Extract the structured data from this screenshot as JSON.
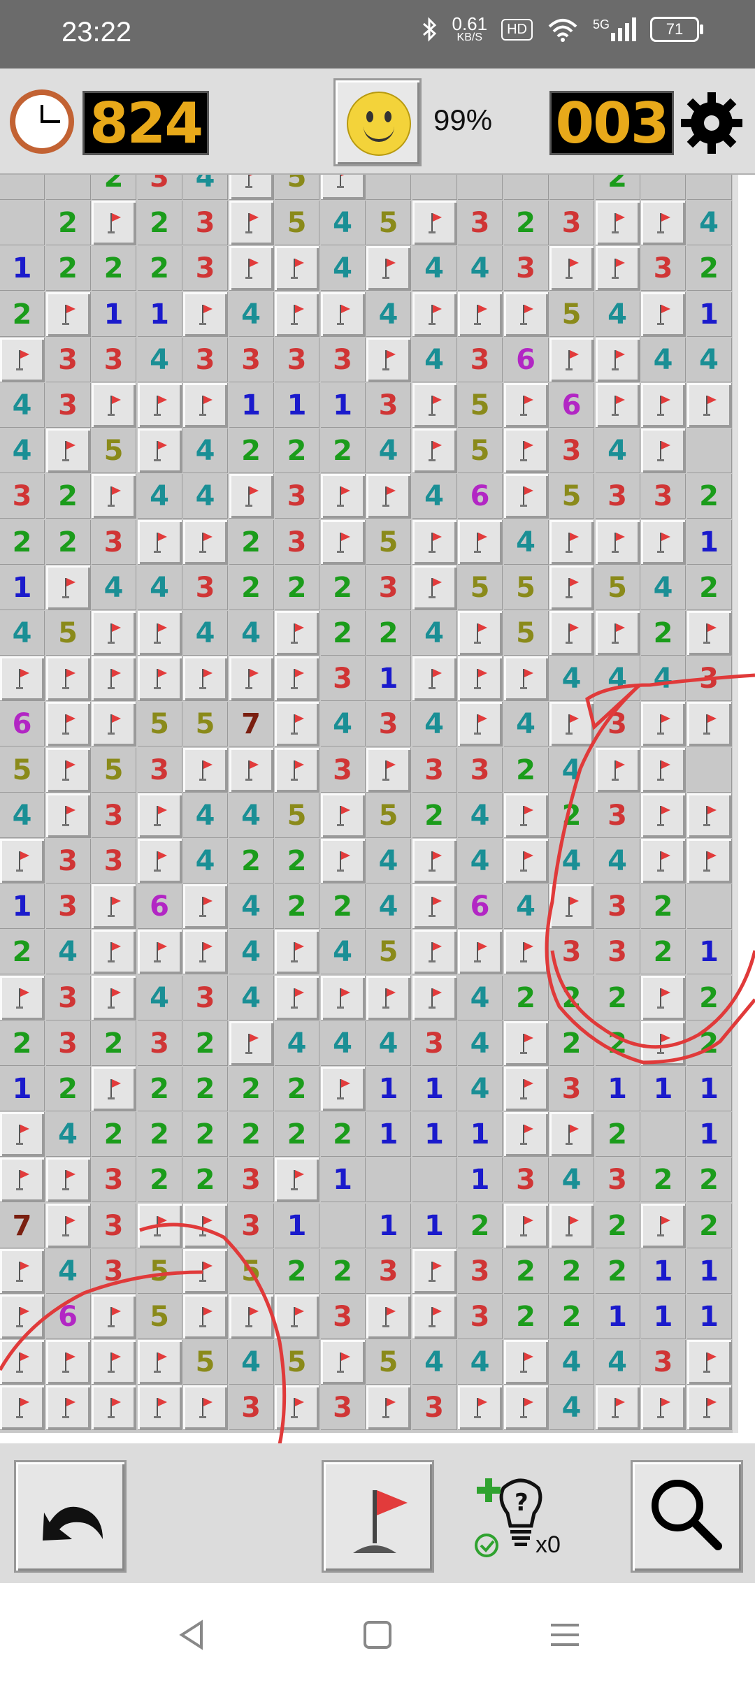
{
  "status_bar": {
    "time": "23:22",
    "net_speed_value": "0.61",
    "net_speed_unit": "KB/S",
    "hd": "HD",
    "network": "5G",
    "battery": "71"
  },
  "header": {
    "timer": "824",
    "percent": "99%",
    "mines_left": "003"
  },
  "board": {
    "cols": 16,
    "rows_visible": 28,
    "rows": [
      "..234F5F.....2..",
      ".2F23F545F323FF44F",
      "1222 3FF4F443FF32",
      "2F11F4FF4FFF54F1",
      "F3343333F436FF443",
      "43FFF1113F5F6FFF",
      "4F5F4222 4F5F34F",
      "32F44F3FF46F533 2",
      "223FF23F5FF4FFF1",
      "1F443222 3F55F542",
      "45FF44F224F5FF2F",
      "FFFFFFF31FFF4443",
      "6FF557F434F4F3FF",
      "5F53FFF3F33 24FF",
      "4F3F445F524F23FF",
      "F33F4 22F4F4F44FF",
      "13F6F4224F64F32",
      "24FFF4F45FFF332 1",
      "F3F434FFFF4222F2",
      "23232F4443 4F22F2",
      "12F222 2F114F3111",
      "F4222222111FF2.11",
      "FF3223F1..134322F",
      "7F3FF31.112FF2F2",
      "F435F52 23F32 2211",
      "F6F5FFF3FF32 2111",
      "FFFF545F544F4 43F",
      "FFFFF3F3F3FF4FFFF"
    ]
  },
  "toolbar": {
    "hint_count": "x0"
  },
  "colors": {
    "1": "#1a1acc",
    "2": "#1b9c1b",
    "3": "#d03535",
    "4": "#1a8f95",
    "5": "#8a8a1a",
    "6": "#b226c4",
    "7": "#7a1f10"
  }
}
